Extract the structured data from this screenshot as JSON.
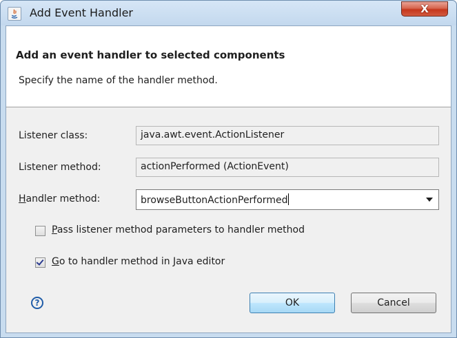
{
  "window": {
    "title": "Add Event Handler",
    "close_glyph": "X"
  },
  "header": {
    "title": "Add an event handler to selected components",
    "description": "Specify the name of the handler method."
  },
  "form": {
    "listener_class": {
      "label": "Listener class:",
      "value": "java.awt.event.ActionListener"
    },
    "listener_method": {
      "label": "Listener method:",
      "value": "actionPerformed (ActionEvent)"
    },
    "handler_method": {
      "label_mnemonic": "H",
      "label_rest": "andler method:",
      "value": "browseButtonActionPerformed"
    }
  },
  "options": {
    "pass_params": {
      "mnemonic": "P",
      "label_rest": "ass listener method parameters to handler method",
      "checked": false
    },
    "goto_editor": {
      "mnemonic": "G",
      "label_rest": "o to handler method in Java editor",
      "checked": true
    }
  },
  "buttons": {
    "ok": "OK",
    "cancel": "Cancel"
  },
  "icons": {
    "app": "java-app-icon",
    "help": "help-icon",
    "help_glyph": "?"
  },
  "colors": {
    "titlebar": "#c8dcef",
    "close": "#c5371d",
    "default_button": "#bee6fd"
  }
}
